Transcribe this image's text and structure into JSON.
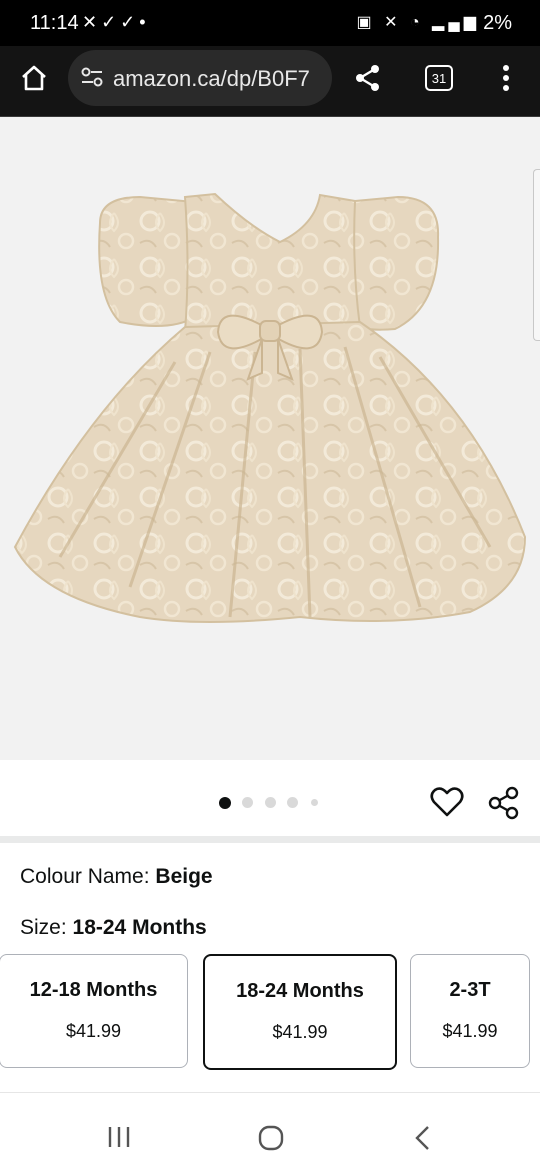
{
  "status_bar": {
    "time": "11:14",
    "battery": "2%"
  },
  "browser": {
    "url": "amazon.ca/dp/B0F7",
    "tab_count": "31"
  },
  "product": {
    "image_alt": "Beige jacquard puff-sleeve girls dress with bow",
    "carousel": {
      "total": 5,
      "active_index": 0
    }
  },
  "variation": {
    "colour_label": "Colour Name:",
    "colour_value": "Beige",
    "size_label": "Size:",
    "size_value": "18-24 Months",
    "sizes": [
      {
        "name": "12-18 Months",
        "price": "$41.99",
        "selected": false
      },
      {
        "name": "18-24 Months",
        "price": "$41.99",
        "selected": true
      },
      {
        "name": "2-3T",
        "price": "$41.99",
        "selected": false
      }
    ]
  },
  "icons": {
    "home": "home-icon",
    "site_settings": "tune-icon",
    "share": "share-icon",
    "tabs": "tab-switcher-icon",
    "menu": "more-vert-icon",
    "wishlist": "heart-icon",
    "product_share": "share-icon",
    "recents": "recents-icon",
    "home_nav": "home-circle-icon",
    "back": "back-icon"
  }
}
